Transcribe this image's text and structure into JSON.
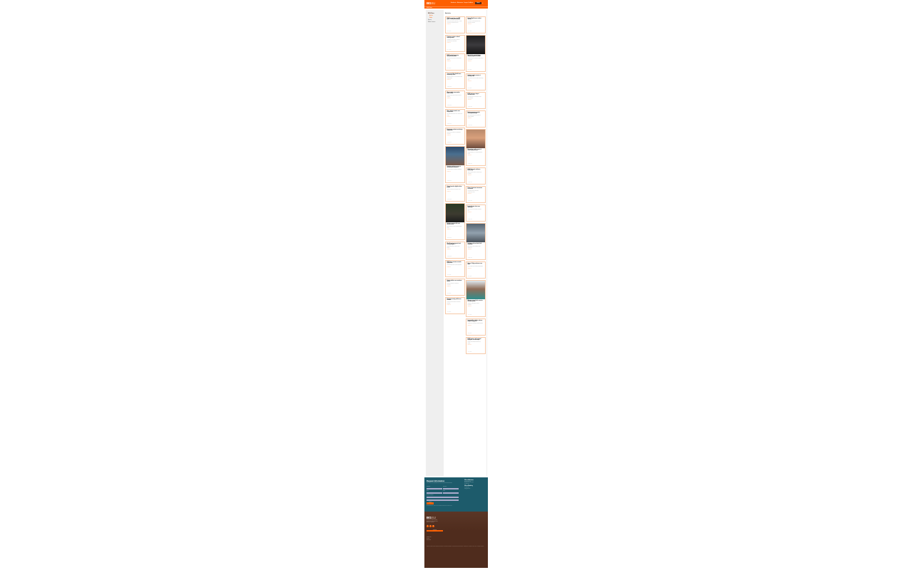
{
  "header": {
    "logo_main": "BG",
    "logo_suffix": "SU",
    "nav": [
      "Academics",
      "Admissions",
      "Campus Life",
      "About"
    ],
    "apply_label": "Apply",
    "search_icon": "search-icon",
    "subbar_label": "BGSU News"
  },
  "sidebar": {
    "items": [
      {
        "label": "BGSU News",
        "style": "active"
      },
      {
        "label": "Articles",
        "style": "sub"
      },
      {
        "label": "Media",
        "style": "sub"
      },
      {
        "label": "Experts",
        "style": "grey"
      },
      {
        "label": "Media Contacts",
        "style": "grey"
      }
    ]
  },
  "content": {
    "title": "Articles",
    "more_label": "Read more",
    "cards": [
      {
        "title": "BGSU researchers earn NSF grant to study water quality",
        "excerpt": "Faculty and students collaborate on a multi-year project examining Lake Erie.",
        "date": "Sep 5, 2019",
        "img": ""
      },
      {
        "title": "Falcon Flight honors student veterans",
        "excerpt": "The annual event brings together the University community.",
        "date": "Sep 4, 2019",
        "img": ""
      },
      {
        "title": "Professor receives national teaching award",
        "excerpt": "Recognized for innovative classroom approaches and mentorship.",
        "date": "Sep 4, 2019",
        "img": ""
      },
      {
        "title": "New faculty member brings industry expertise to BGSU",
        "excerpt": "Joining the College of Business with decades of experience.",
        "date": "Sep 3, 2019",
        "img": "photo-dark"
      },
      {
        "title": "BGSU ranked among top national universities",
        "excerpt": "U.S. News & World Report releases 2020 rankings.",
        "date": "Sep 3, 2019",
        "img": ""
      },
      {
        "title": "Students explore careers at annual job fair",
        "excerpt": "More than 200 employers visited campus this week.",
        "date": "Sep 2, 2019",
        "img": ""
      },
      {
        "title": "Center for Public Health hosts community forum",
        "excerpt": "Discussion focused on rural health access in northwest Ohio.",
        "date": "Aug 30, 2019",
        "img": ""
      },
      {
        "title": "BGSU welcomes largest freshman class",
        "excerpt": "New Falcons move into residence halls across campus.",
        "date": "Aug 29, 2019",
        "img": ""
      },
      {
        "title": "Alumna leads conservation effort in Ohio",
        "excerpt": "Graduate applies field research to protect wetlands.",
        "date": "Aug 28, 2019",
        "img": ""
      },
      {
        "title": "Nursing program expands clinical partnerships",
        "excerpt": "Students gain hands-on experience in regional hospitals.",
        "date": "Aug 27, 2019",
        "img": ""
      },
      {
        "title": "Music faculty premiere new composition",
        "excerpt": "The work debuted at the Moore Musical Arts Center.",
        "date": "Aug 26, 2019",
        "img": ""
      },
      {
        "title": "Researcher studies impact of social media on teens",
        "excerpt": "Findings published in a leading psychology journal.",
        "date": "Aug 23, 2019",
        "img": "photo-warm"
      },
      {
        "title": "Engineering students win design competition",
        "excerpt": "Team project recognized for sustainable innovation.",
        "date": "Aug 22, 2019",
        "img": ""
      },
      {
        "title": "BGSU Firelands celebrates anniversary",
        "excerpt": "Campus marks decades of service to the community.",
        "date": "Aug 21, 2019",
        "img": ""
      },
      {
        "title": "Graduate student presents at international conference",
        "excerpt": "Research focuses on language acquisition.",
        "date": "Aug 20, 2019",
        "img": "photo-blue"
      },
      {
        "title": "Theatre department announces fall season",
        "excerpt": "Productions include classic and contemporary works.",
        "date": "Aug 19, 2019",
        "img": ""
      },
      {
        "title": "Library launches digital archive project",
        "excerpt": "Historic collections now available online.",
        "date": "Aug 16, 2019",
        "img": ""
      },
      {
        "title": "Faculty Senate elects new leadership",
        "excerpt": "Officers will serve through the academic year.",
        "date": "Aug 15, 2019",
        "img": ""
      },
      {
        "title": "Aviation program adds new aircraft to fleet",
        "excerpt": "Students train on modern equipment at the airport.",
        "date": "Aug 14, 2019",
        "img": "photo-green"
      },
      {
        "title": "Geology professor leads field expedition",
        "excerpt": "Students study rock formations in the western U.S.",
        "date": "Aug 13, 2019",
        "img": "photo-grey"
      },
      {
        "title": "Ohio Department grants fund literacy program",
        "excerpt": "Partnership supports reading in local schools.",
        "date": "Aug 12, 2019",
        "img": ""
      },
      {
        "title": "Honors College welcomes new dean",
        "excerpt": "Leader brings vision for student scholarship.",
        "date": "Aug 9, 2019",
        "img": ""
      },
      {
        "title": "BGSU hosts summer research symposium",
        "excerpt": "Undergraduates share projects with faculty.",
        "date": "Aug 8, 2019",
        "img": ""
      },
      {
        "title": "Alumnus named chief executive of health system",
        "excerpt": "Graduate credits BGSU for career foundation.",
        "date": "Aug 7, 2019",
        "img": "photo-teal"
      },
      {
        "title": "Student athletes earn academic honors",
        "excerpt": "Falcons recognized for classroom excellence.",
        "date": "Aug 6, 2019",
        "img": ""
      },
      {
        "title": "Sustainability initiative reduces campus energy use",
        "excerpt": "Upgrades cut consumption across buildings.",
        "date": "Aug 5, 2019",
        "img": ""
      },
      {
        "title": "Education faculty publish new textbook",
        "excerpt": "Resource supports teacher preparation programs.",
        "date": "Aug 2, 2019",
        "img": ""
      },
      {
        "title": "BGSU partners with regional employers on internships",
        "excerpt": "Program connects students with local industry.",
        "date": "Aug 1, 2019",
        "img": ""
      }
    ]
  },
  "pager": {
    "prev": "‹",
    "pages": [
      "1",
      "2",
      "3"
    ],
    "current": "1",
    "next": "›"
  },
  "request": {
    "title": "Request Information",
    "intro": "Want to learn more about BGSU? Fill out the form and we will be in touch.",
    "fields": [
      "First Name",
      "Last Name",
      "Email",
      "Phone",
      "Program of Interest"
    ],
    "submit": "Submit",
    "fine": "By submitting this form, I agree to receive information from Bowling Green State University.",
    "contact_heading": "Office of Admissions",
    "contact_lines": [
      "200 University Hall",
      "Bowling Green, OH 43403",
      "419-372-2478"
    ],
    "contact_heading2": "Office of Marketing",
    "contact_lines2": [
      "419-372-2616",
      "news@bgsu.edu"
    ]
  },
  "footer": {
    "logo_main": "BG",
    "logo_suffix": "SU",
    "address": [
      "Bowling Green State University",
      "Bowling Green, OH 43403-0001",
      "Phone: 419-372-2531"
    ],
    "social": [
      "facebook-icon",
      "twitter-icon",
      "instagram-icon"
    ],
    "cta": "Visit BGSU",
    "links": [
      "Campus Map",
      "Directory",
      "Employment"
    ],
    "legal": "Bowling Green State University provides equal opportunity in employment and education. © 2019 Bowling Green State University. All rights reserved. Accessibility | Privacy | Title IX | Consumer Information"
  },
  "colors": {
    "accent": "#fd5f00",
    "brown": "#4f2c1d",
    "teal": "#1d5b6b"
  }
}
